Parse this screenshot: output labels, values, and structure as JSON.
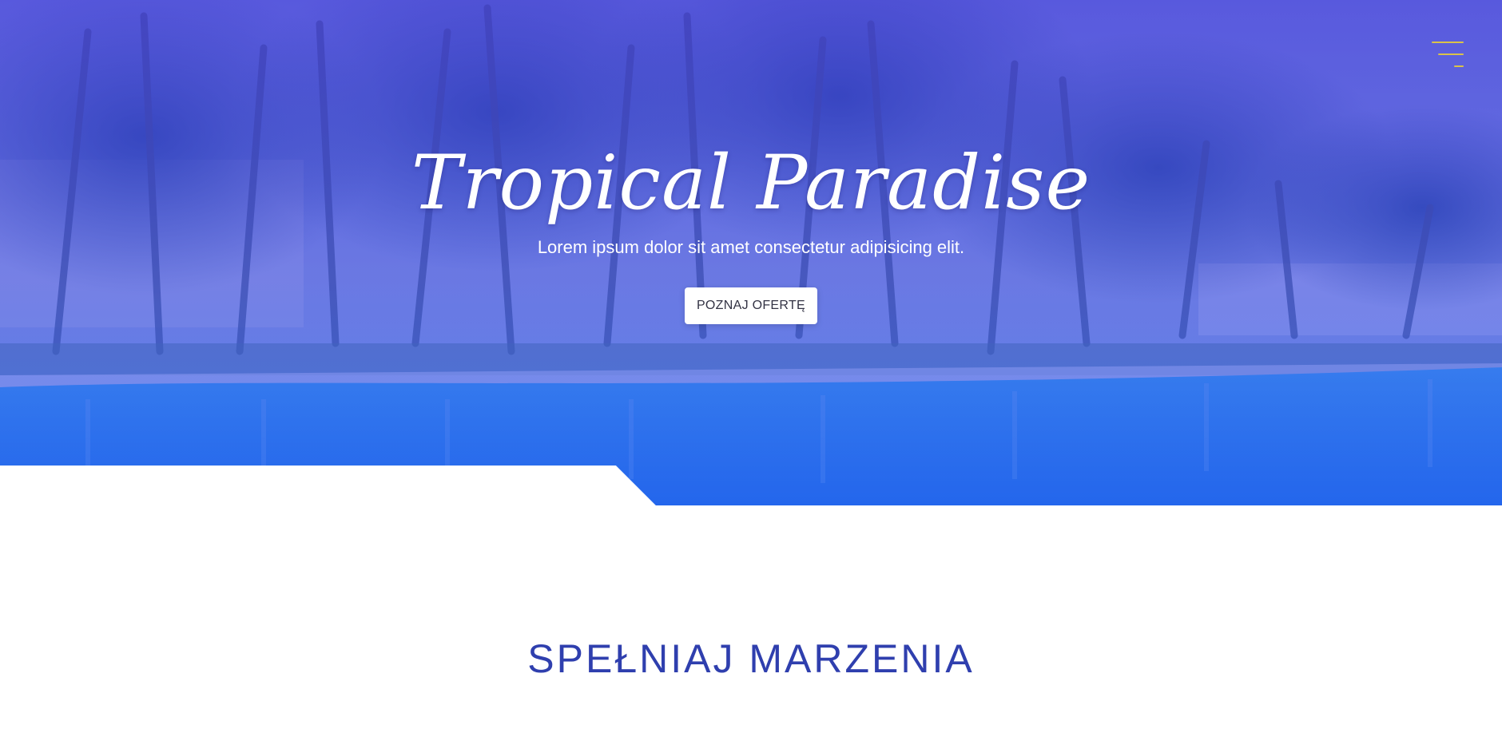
{
  "header": {
    "menu_icon": "hamburger-menu-icon",
    "menu_color": "#d9c24a"
  },
  "hero": {
    "title": "Tropical Paradise",
    "subtitle": "Lorem ipsum dolor sit amet consectetur adipisicing elit.",
    "cta_label": "POZNAJ OFERTĘ",
    "background_image": "tropical-resort-pool-with-palm-trees",
    "overlay_color": "#4a35e0"
  },
  "section": {
    "title": "SPEŁNIAJ MARZENIA",
    "title_color": "#2f3fae"
  }
}
